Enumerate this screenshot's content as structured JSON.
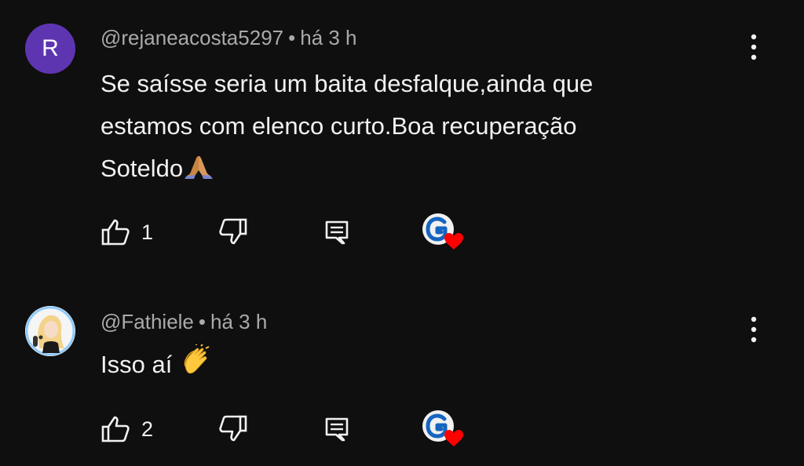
{
  "comments": [
    {
      "avatar_letter": "R",
      "avatar_color": "#5e35b1",
      "author": "@rejaneacosta5297",
      "separator": "•",
      "time": "há 3 h",
      "text_lines": [
        "Se saísse seria um baita desfalque,ainda que",
        "estamos com elenco curto.Boa recuperação",
        "Soteldo"
      ],
      "emoji": "🙏🏽",
      "likes": "1",
      "icons": {
        "like": "thumb-up-icon",
        "dislike": "thumb-down-icon",
        "reply": "reply-icon",
        "creator_heart": "creator-heart-icon",
        "more": "more-vertical-icon"
      }
    },
    {
      "author": "@Fathiele",
      "separator": "•",
      "time": "há 3 h",
      "text_lines": [
        "Isso aí"
      ],
      "emoji": "👏",
      "likes": "2",
      "icons": {
        "like": "thumb-up-icon",
        "dislike": "thumb-down-icon",
        "reply": "reply-icon",
        "creator_heart": "creator-heart-icon",
        "more": "more-vertical-icon"
      }
    }
  ],
  "colors": {
    "background": "#0f0f0f",
    "text": "#f1f1f1",
    "meta": "#aaaaaa",
    "heart": "#ff0000"
  }
}
